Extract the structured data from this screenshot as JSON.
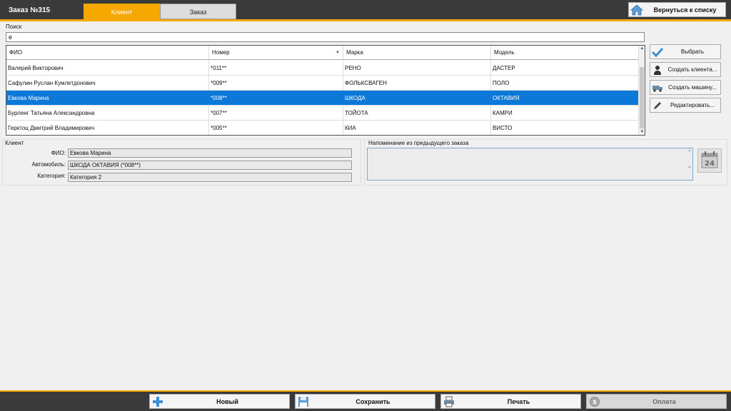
{
  "header": {
    "title": "Заказ №315",
    "tabs": [
      {
        "label": "Клиент",
        "active": true
      },
      {
        "label": "Заказ",
        "active": false
      }
    ],
    "back_button": "Вернуться к списку",
    "accent_color": "#f5a800"
  },
  "search": {
    "label": "Поиск",
    "value": "е"
  },
  "grid": {
    "columns": [
      "ФИО",
      "Номер",
      "Марка",
      "Модель"
    ],
    "sorted_column": "Номер",
    "rows": [
      {
        "name": "Валерий Викторович",
        "number": "*011**",
        "make": "РЕНО",
        "model": "ДАСТЕР",
        "selected": false
      },
      {
        "name": "Сафулин Руслан Кумлетдонович",
        "number": "*009**",
        "make": "ФОЛЬКСВАГЕН",
        "model": "ПОЛО",
        "selected": false
      },
      {
        "name": "Евкова Марина",
        "number": "*008**",
        "make": "ШКОДА",
        "model": "ОКТАВИЯ",
        "selected": true
      },
      {
        "name": "Бурленг Татьяна Александровна",
        "number": "*007**",
        "make": "ТОЙОТА",
        "model": "КАМРИ",
        "selected": false
      },
      {
        "name": "Герктоц Дмитрий Владимирович",
        "number": "*005**",
        "make": "КИА",
        "model": "ВИСТО",
        "selected": false
      }
    ]
  },
  "actions": {
    "select": "Выбрать",
    "create_client": "Создать клиента...",
    "create_car": "Создать машину...",
    "edit": "Редактировать..."
  },
  "client": {
    "title": "Клиент",
    "fio_label": "ФИО:",
    "fio_value": "Евкова Марина",
    "car_label": "Автомобиль:",
    "car_value": "ШКОДА ОКТАВИЯ (*008**)",
    "category_label": "Категория:",
    "category_value": "Категория 2"
  },
  "reminder": {
    "title": "Напоминание из предыдущего заказа",
    "value": "",
    "calendar_day": "24"
  },
  "footer": {
    "new": "Новый",
    "save": "Сохранить",
    "print": "Печать",
    "pay": "Оплата"
  }
}
